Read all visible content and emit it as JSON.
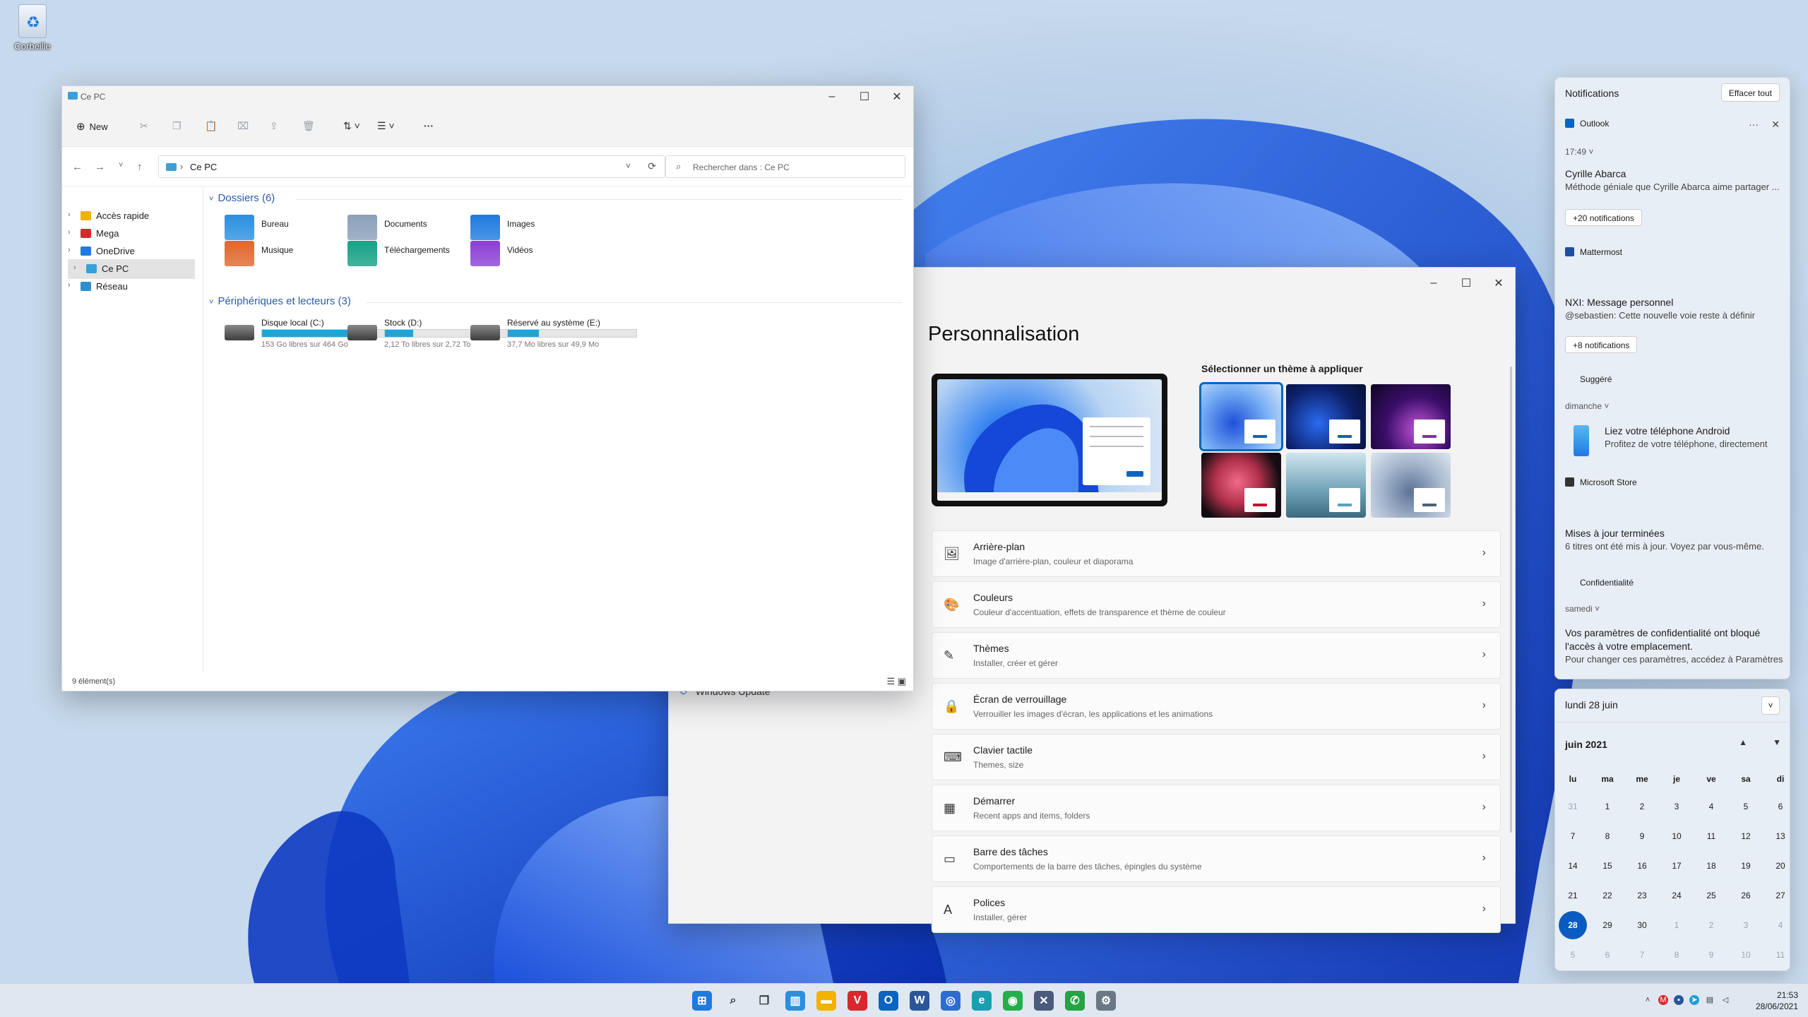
{
  "desktop": {
    "recycle_label": "Corbeille"
  },
  "explorer": {
    "title": "Ce PC",
    "new_label": "New",
    "address": "Ce PC",
    "search_placeholder": "Rechercher dans : Ce PC",
    "sidebar": [
      {
        "label": "Accès rapide",
        "color": "#f2b200"
      },
      {
        "label": "Mega",
        "color": "#d9272e"
      },
      {
        "label": "OneDrive",
        "color": "#1f7ae0"
      },
      {
        "label": "Ce PC",
        "color": "#3aa0d8"
      },
      {
        "label": "Réseau",
        "color": "#2d8fd0"
      }
    ],
    "folders_header": "Dossiers (6)",
    "folders": [
      {
        "label": "Bureau",
        "color": "#2a8fe0"
      },
      {
        "label": "Documents",
        "color": "#8aa0b8"
      },
      {
        "label": "Images",
        "color": "#1f7ae0"
      },
      {
        "label": "Musique",
        "color": "#e0672d"
      },
      {
        "label": "Téléchargements",
        "color": "#16a085"
      },
      {
        "label": "Vidéos",
        "color": "#8b3fd6"
      }
    ],
    "drives_header": "Périphériques et lecteurs (3)",
    "drives": [
      {
        "label": "Disque local (C:)",
        "free": "153 Go libres sur 464 Go",
        "used_fraction": 0.67
      },
      {
        "label": "Stock (D:)",
        "free": "2,12 To libres sur 2,72 To",
        "used_fraction": 0.22
      },
      {
        "label": "Réservé au système (E:)",
        "free": "37,7 Mo libres sur 49,9 Mo",
        "used_fraction": 0.24
      }
    ],
    "status": "9 élément(s)"
  },
  "settings": {
    "nav_windows_update": "Windows Update",
    "page_title": "Personnalisation",
    "theme_label": "Sélectionner un thème à appliquer",
    "rows": [
      {
        "title": "Arrière-plan",
        "sub": "Image d'arrière-plan, couleur et diaporama",
        "icon": "🖼"
      },
      {
        "title": "Couleurs",
        "sub": "Couleur d'accentuation, effets de transparence et thème de couleur",
        "icon": "🎨"
      },
      {
        "title": "Thèmes",
        "sub": "Installer, créer et gérer",
        "icon": "✎"
      },
      {
        "title": "Écran de verrouillage",
        "sub": "Verrouiller les images d'écran, les applications et les animations",
        "icon": "🔒"
      },
      {
        "title": "Clavier tactile",
        "sub": "Themes, size",
        "icon": "⌨"
      },
      {
        "title": "Démarrer",
        "sub": "Recent apps and items, folders",
        "icon": "▦"
      },
      {
        "title": "Barre des tâches",
        "sub": "Comportements de la barre des tâches, épingles du système",
        "icon": "▭"
      },
      {
        "title": "Polices",
        "sub": "Installer, gérer",
        "icon": "A"
      }
    ]
  },
  "notifications": {
    "header": "Notifications",
    "clear_all": "Effacer tout",
    "outlook_app": "Outlook",
    "outlook_time": "17:49",
    "outlook_title": "Cyrille Abarca",
    "outlook_body": "Méthode géniale que Cyrille Abarca aime partager ...",
    "outlook_more": "+20 notifications",
    "mattermost_app": "Mattermost",
    "mattermost_title": "NXI: Message personnel",
    "mattermost_body": "@sebastien: Cette nouvelle voie reste à définir",
    "mattermost_more": "+8 notifications",
    "suggested_app": "Suggéré",
    "suggested_time": "dimanche",
    "suggested_title": "Liez votre téléphone Android",
    "suggested_body": "Profitez de votre téléphone, directement",
    "store_app": "Microsoft Store",
    "store_title": "Mises à jour terminées",
    "store_body": "6 titres ont été mis à jour. Voyez par vous-même.",
    "privacy_app": "Confidentialité",
    "privacy_time": "samedi",
    "privacy_title1": "Vos paramètres de confidentialité ont bloqué",
    "privacy_title2": "l'accès à votre emplacement.",
    "privacy_body": "Pour changer ces paramètres, accédez à Paramètres"
  },
  "calendar": {
    "date_header": "lundi 28 juin",
    "month": "juin 2021",
    "dow": [
      "lu",
      "ma",
      "me",
      "je",
      "ve",
      "sa",
      "di"
    ],
    "weeks": [
      [
        "31",
        "1",
        "2",
        "3",
        "4",
        "5",
        "6"
      ],
      [
        "7",
        "8",
        "9",
        "10",
        "11",
        "12",
        "13"
      ],
      [
        "14",
        "15",
        "16",
        "17",
        "18",
        "19",
        "20"
      ],
      [
        "21",
        "22",
        "23",
        "24",
        "25",
        "26",
        "27"
      ],
      [
        "28",
        "29",
        "30",
        "1",
        "2",
        "3",
        "4"
      ],
      [
        "5",
        "6",
        "7",
        "8",
        "9",
        "10",
        "11"
      ]
    ],
    "today": "28"
  },
  "taskbar": {
    "time": "21:53",
    "date": "28/06/2021",
    "apps": [
      {
        "name": "start",
        "color": "#1f7ae0",
        "glyph": "⊞"
      },
      {
        "name": "search",
        "color": "#333333",
        "glyph": "⌕"
      },
      {
        "name": "task-view",
        "color": "#333333",
        "glyph": "❐"
      },
      {
        "name": "widgets",
        "color": "#2a8fe0",
        "glyph": "▥"
      },
      {
        "name": "file-explorer",
        "color": "#f2b200",
        "glyph": "▬"
      },
      {
        "name": "vivaldi",
        "color": "#d9272e",
        "glyph": "V"
      },
      {
        "name": "outlook",
        "color": "#0a64c2",
        "glyph": "O"
      },
      {
        "name": "word",
        "color": "#2b579a",
        "glyph": "W"
      },
      {
        "name": "app-circle",
        "color": "#2d6cd0",
        "glyph": "◎"
      },
      {
        "name": "edge",
        "color": "#1a9fb0",
        "glyph": "e"
      },
      {
        "name": "app-green",
        "color": "#22b04b",
        "glyph": "◉"
      },
      {
        "name": "app-chart",
        "color": "#4a5b7c",
        "glyph": "✕"
      },
      {
        "name": "whatsapp",
        "color": "#25a244",
        "glyph": "✆"
      },
      {
        "name": "settings",
        "color": "#6b7785",
        "glyph": "⚙"
      }
    ]
  }
}
